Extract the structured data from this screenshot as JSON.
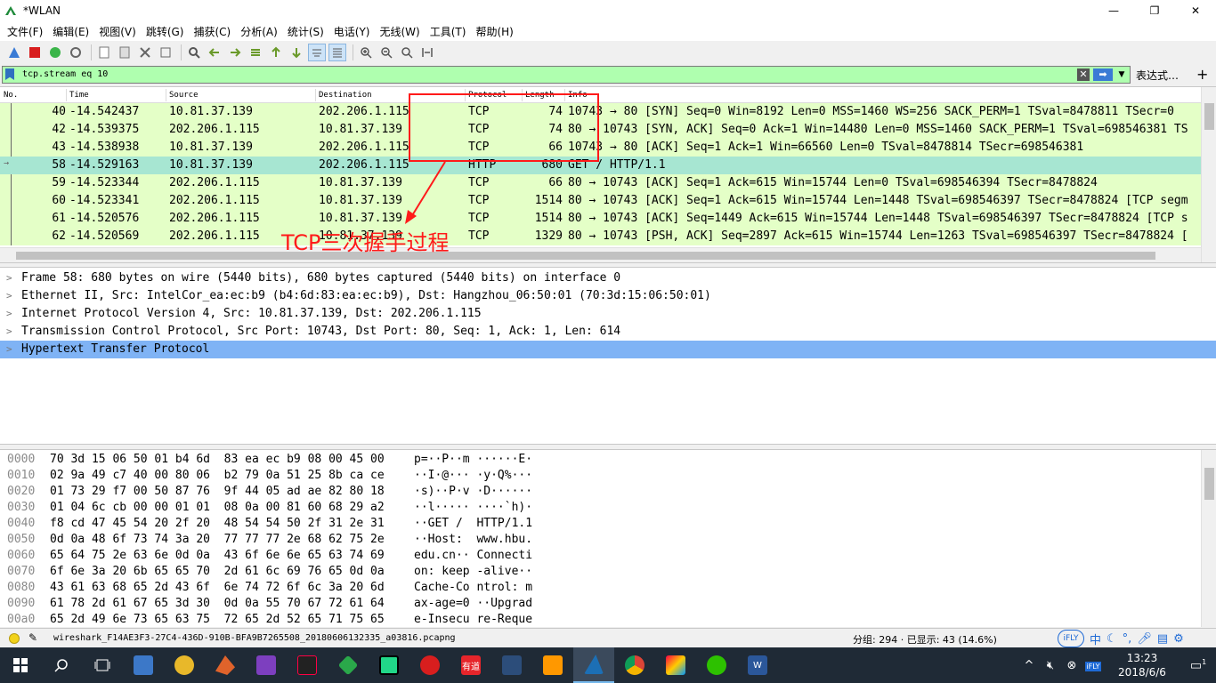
{
  "window": {
    "title": "*WLAN",
    "min": "—",
    "max": "❐",
    "close": "✕"
  },
  "menu": [
    "文件(F)",
    "编辑(E)",
    "视图(V)",
    "跳转(G)",
    "捕获(C)",
    "分析(A)",
    "统计(S)",
    "电话(Y)",
    "无线(W)",
    "工具(T)",
    "帮助(H)"
  ],
  "filter": {
    "value": "tcp.stream eq 10",
    "expression_label": "表达式…",
    "plus": "+"
  },
  "columns": [
    "No.",
    "Time",
    "Source",
    "Destination",
    "Protocol",
    "Length",
    "Info"
  ],
  "packets": [
    {
      "no": "40",
      "time": "-14.542437",
      "src": "10.81.37.139",
      "dst": "202.206.1.115",
      "proto": "TCP",
      "len": "74",
      "info": "10743 → 80 [SYN] Seq=0 Win=8192 Len=0 MSS=1460 WS=256 SACK_PERM=1 TSval=8478811 TSecr=0"
    },
    {
      "no": "42",
      "time": "-14.539375",
      "src": "202.206.1.115",
      "dst": "10.81.37.139",
      "proto": "TCP",
      "len": "74",
      "info": "80 → 10743 [SYN, ACK] Seq=0 Ack=1 Win=14480 Len=0 MSS=1460 SACK_PERM=1 TSval=698546381 TS"
    },
    {
      "no": "43",
      "time": "-14.538938",
      "src": "10.81.37.139",
      "dst": "202.206.1.115",
      "proto": "TCP",
      "len": "66",
      "info": "10743 → 80 [ACK] Seq=1 Ack=1 Win=66560 Len=0 TSval=8478814 TSecr=698546381"
    },
    {
      "no": "58",
      "time": "-14.529163",
      "src": "10.81.37.139",
      "dst": "202.206.1.115",
      "proto": "HTTP",
      "len": "680",
      "info": "GET / HTTP/1.1"
    },
    {
      "no": "59",
      "time": "-14.523344",
      "src": "202.206.1.115",
      "dst": "10.81.37.139",
      "proto": "TCP",
      "len": "66",
      "info": "80 → 10743 [ACK] Seq=1 Ack=615 Win=15744 Len=0 TSval=698546394 TSecr=8478824"
    },
    {
      "no": "60",
      "time": "-14.523341",
      "src": "202.206.1.115",
      "dst": "10.81.37.139",
      "proto": "TCP",
      "len": "1514",
      "info": "80 → 10743 [ACK] Seq=1 Ack=615 Win=15744 Len=1448 TSval=698546397 TSecr=8478824 [TCP segm"
    },
    {
      "no": "61",
      "time": "-14.520576",
      "src": "202.206.1.115",
      "dst": "10.81.37.139",
      "proto": "TCP",
      "len": "1514",
      "info": "80 → 10743 [ACK] Seq=1449 Ack=615 Win=15744 Len=1448 TSval=698546397 TSecr=8478824 [TCP s"
    },
    {
      "no": "62",
      "time": "-14.520569",
      "src": "202.206.1.115",
      "dst": "10.81.37.139",
      "proto": "TCP",
      "len": "1329",
      "info": "80 → 10743 [PSH, ACK] Seq=2897 Ack=615 Win=15744 Len=1263 TSval=698546397 TSecr=8478824 ["
    }
  ],
  "details": [
    "Frame 58: 680 bytes on wire (5440 bits), 680 bytes captured (5440 bits) on interface 0",
    "Ethernet II, Src: IntelCor_ea:ec:b9 (b4:6d:83:ea:ec:b9), Dst: Hangzhou_06:50:01 (70:3d:15:06:50:01)",
    "Internet Protocol Version 4, Src: 10.81.37.139, Dst: 202.206.1.115",
    "Transmission Control Protocol, Src Port: 10743, Dst Port: 80, Seq: 1, Ack: 1, Len: 614",
    "Hypertext Transfer Protocol"
  ],
  "bytes": [
    {
      "off": "0000",
      "hex": "70 3d 15 06 50 01 b4 6d  83 ea ec b9 08 00 45 00",
      "ascii": "p=··P··m ······E·"
    },
    {
      "off": "0010",
      "hex": "02 9a 49 c7 40 00 80 06  b2 79 0a 51 25 8b ca ce",
      "ascii": "··I·@··· ·y·Q%···"
    },
    {
      "off": "0020",
      "hex": "01 73 29 f7 00 50 87 76  9f 44 05 ad ae 82 80 18",
      "ascii": "·s)··P·v ·D······"
    },
    {
      "off": "0030",
      "hex": "01 04 6c cb 00 00 01 01  08 0a 00 81 60 68 29 a2",
      "ascii": "··l····· ····`h)·"
    },
    {
      "off": "0040",
      "hex": "f8 cd 47 45 54 20 2f 20  48 54 54 50 2f 31 2e 31",
      "ascii": "··GET /  HTTP/1.1"
    },
    {
      "off": "0050",
      "hex": "0d 0a 48 6f 73 74 3a 20  77 77 77 2e 68 62 75 2e",
      "ascii": "··Host:  www.hbu."
    },
    {
      "off": "0060",
      "hex": "65 64 75 2e 63 6e 0d 0a  43 6f 6e 6e 65 63 74 69",
      "ascii": "edu.cn·· Connecti"
    },
    {
      "off": "0070",
      "hex": "6f 6e 3a 20 6b 65 65 70  2d 61 6c 69 76 65 0d 0a",
      "ascii": "on: keep -alive··"
    },
    {
      "off": "0080",
      "hex": "43 61 63 68 65 2d 43 6f  6e 74 72 6f 6c 3a 20 6d",
      "ascii": "Cache-Co ntrol: m"
    },
    {
      "off": "0090",
      "hex": "61 78 2d 61 67 65 3d 30  0d 0a 55 70 67 72 61 64",
      "ascii": "ax-age=0 ··Upgrad"
    },
    {
      "off": "00a0",
      "hex": "65 2d 49 6e 73 65 63 75  72 65 2d 52 65 71 75 65",
      "ascii": "e-Insecu re-Reque"
    }
  ],
  "status": {
    "file": "wireshark_F14AE3F3-27C4-436D-910B-BFA9B7265508_20180606132335_a03816.pcapng",
    "packets": "分组: 294 · 已显示: 43 (14.6%)",
    "ime_logo": "iFLY",
    "ime_lang": "中"
  },
  "annotation": {
    "text": "TCP三次握手过程"
  },
  "taskbar": {
    "apps": [
      "file-explorer",
      "paw",
      "matlab",
      "visual-studio",
      "intellij",
      "android",
      "pycharm",
      "netease-music",
      "youdao",
      "eclipse",
      "sublime",
      "wireshark",
      "chrome",
      "paint",
      "wechat",
      "word"
    ],
    "youdao_label": "有道",
    "time": "13:23",
    "date": "2018/6/6",
    "notify_count": "1",
    "tray_ifly": "iFLY"
  }
}
